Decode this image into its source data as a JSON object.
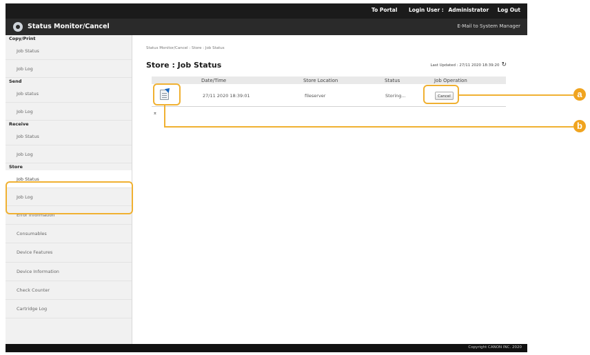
{
  "header": {
    "links": [
      "To Portal",
      "Login User :",
      "Administrator",
      "Log Out"
    ],
    "app_title": "Status Monitor/Cancel",
    "mail_link": "E-Mail to System Manager"
  },
  "sidebar": {
    "sections": [
      {
        "title": "Copy/Print",
        "items": [
          "Job Status",
          "Job Log"
        ]
      },
      {
        "title": "Send",
        "items": [
          "Job status",
          "Job Log"
        ]
      },
      {
        "title": "Receive",
        "items": [
          "Job Status",
          "Job Log"
        ]
      },
      {
        "title": "Store",
        "items": [
          "Job Status",
          "Job Log"
        ]
      }
    ],
    "other_items": [
      "Error Information",
      "Consumables",
      "Device Features",
      "Device Information",
      "Check Counter",
      "Cartridge Log"
    ]
  },
  "main": {
    "breadcrumb": "Status Monitor/Cancel : Store : Job Status",
    "title": "Store : Job Status",
    "last_updated": "Last Updated : 27/11 2020 18:39:20",
    "columns": [
      "Date/Time",
      "Store Location",
      "Status",
      "Job Operation"
    ],
    "rows": [
      {
        "datetime": "27/11 2020 18:39:01",
        "location": "fileserver",
        "status": "Storing...",
        "operation": "Cancel"
      }
    ],
    "to_top": "⌅"
  },
  "footer": {
    "copyright": "Copyright CANON INC. 2020"
  },
  "callouts": [
    "a",
    "b"
  ],
  "colors": {
    "accent": "#f0b030",
    "header": "#1b1b1b",
    "icon_arrow": "#1565c0"
  }
}
